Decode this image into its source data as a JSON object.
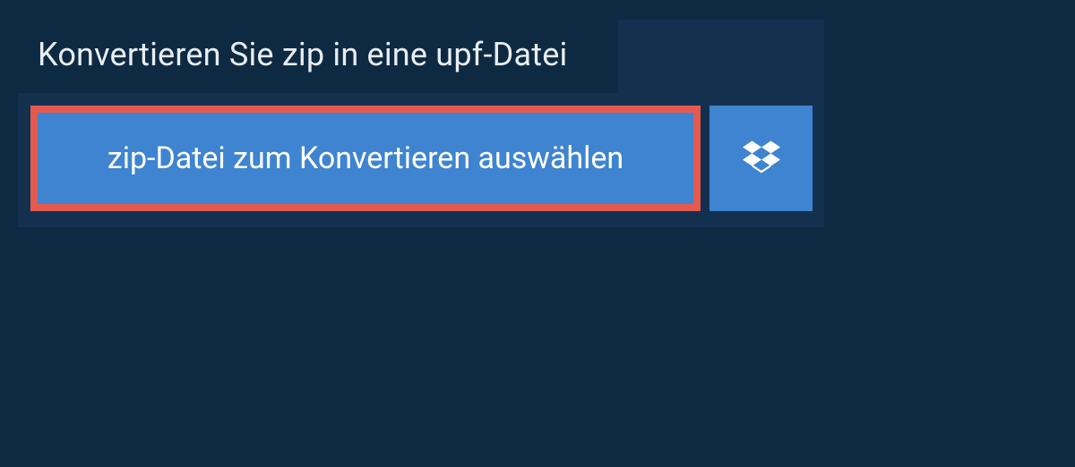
{
  "heading": "Konvertieren Sie zip in eine upf-Datei",
  "choose_file_label": "zip-Datei zum Konvertieren auswählen",
  "colors": {
    "page_bg": "#0e2a42",
    "panel_bg": "#13314f",
    "button_bg": "#3e84d0",
    "highlight_border": "#e45a4f",
    "text_light": "#e8edf2",
    "text_white": "#ffffff"
  }
}
